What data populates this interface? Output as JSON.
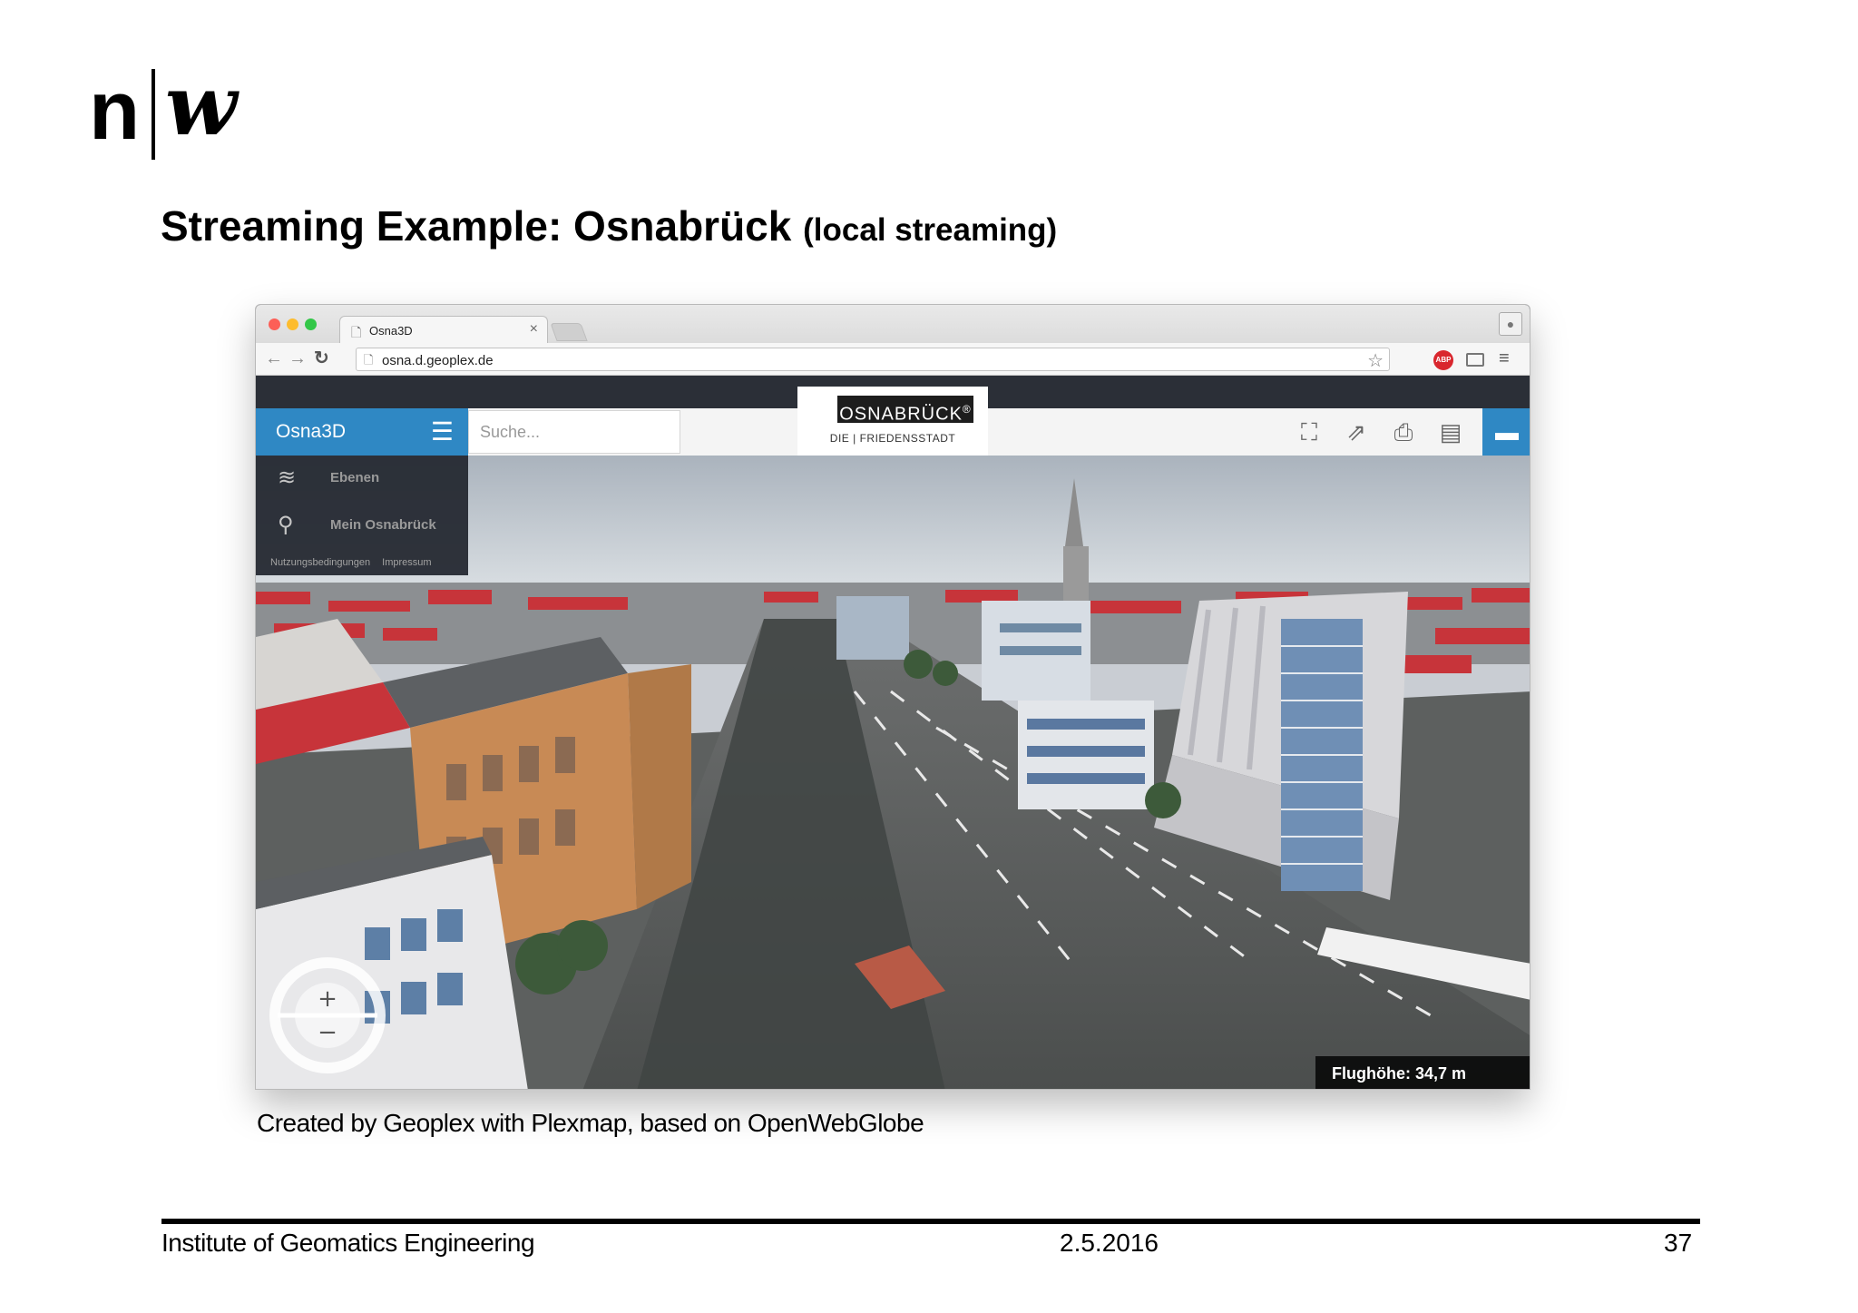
{
  "logo": {
    "letter_n": "n",
    "letter_w": "w"
  },
  "slide": {
    "title_main": "Streaming Example: Osnabrück ",
    "title_sub": "(local streaming)",
    "caption": "Created by Geoplex with Plexmap, based on OpenWebGlobe"
  },
  "browser": {
    "tab_title": "Osna3D",
    "tab_close": "×",
    "url": "osna.d.geoplex.de",
    "abp_label": "ABP",
    "icons": [
      "back-arrow-icon",
      "forward-arrow-icon",
      "reload-icon",
      "bookmark-star-icon",
      "adblock-icon",
      "cast-icon",
      "chrome-menu-icon",
      "profile-icon"
    ]
  },
  "app": {
    "brand": "Osna3D",
    "menu_icon": "hamburger-icon",
    "search_placeholder": "Suche...",
    "city_logo": "OSNABRÜCK",
    "city_logo_reg": "®",
    "city_tagline": "DIE | FRIEDENSSTADT",
    "tools": [
      "fullscreen-icon",
      "share-icon",
      "print-icon",
      "map-icon",
      "toolbox-icon"
    ],
    "side_items": [
      {
        "label": "Ebenen",
        "icon": "layers-icon"
      },
      {
        "label": "Mein Osnabrück",
        "icon": "location-pin-icon"
      }
    ],
    "side_links": [
      "Nutzungsbedingungen",
      "Impressum"
    ],
    "altitude": "Flughöhe: 34,7 m",
    "colors": {
      "accent": "#2f88c4",
      "panel": "#252931",
      "roof": "#c7343a"
    }
  },
  "footer": {
    "institute": "Institute of Geomatics Engineering",
    "date": "2.5.2016",
    "page": "37"
  }
}
